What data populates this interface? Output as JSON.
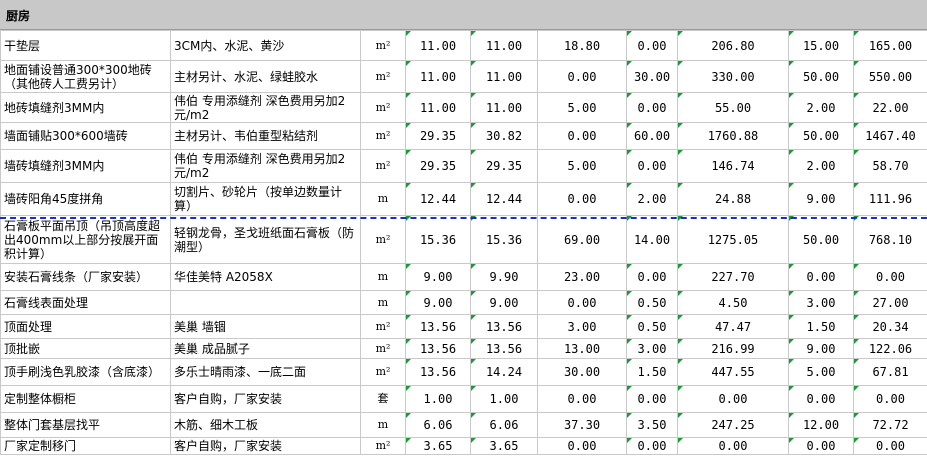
{
  "section": {
    "title": "厨房"
  },
  "rows": [
    {
      "name": "干垫层",
      "material": "3CM内、水泥、黄沙",
      "unit": "m²",
      "v1": "11.00",
      "v2": "11.00",
      "v3": "18.80",
      "v4": "0.00",
      "v5": "206.80",
      "v6": "15.00",
      "v7": "165.00"
    },
    {
      "name": "地面铺设普通300*300地砖（其他砖人工费另计）",
      "material": "主材另计、水泥、绿蛙胶水",
      "unit": "m²",
      "v1": "11.00",
      "v2": "11.00",
      "v3": "0.00",
      "v4": "30.00",
      "v5": "330.00",
      "v6": "50.00",
      "v7": "550.00"
    },
    {
      "name": "地砖填缝剂3MM内",
      "material": "伟伯 专用添缝剂  深色费用另加2元/m2",
      "unit": "m²",
      "v1": "11.00",
      "v2": "11.00",
      "v3": "5.00",
      "v4": "0.00",
      "v5": "55.00",
      "v6": "2.00",
      "v7": "22.00"
    },
    {
      "name": "墙面铺贴300*600墙砖",
      "material": "主材另计、韦伯重型粘结剂",
      "unit": "m²",
      "v1": "29.35",
      "v2": "30.82",
      "v3": "0.00",
      "v4": "60.00",
      "v5": "1760.88",
      "v6": "50.00",
      "v7": "1467.40"
    },
    {
      "name": "墙砖填缝剂3MM内",
      "material": "伟伯 专用添缝剂  深色费用另加2元/m2",
      "unit": "m²",
      "v1": "29.35",
      "v2": "29.35",
      "v3": "5.00",
      "v4": "0.00",
      "v5": "146.74",
      "v6": "2.00",
      "v7": "58.70"
    },
    {
      "name": "墙砖阳角45度拼角",
      "material": "切割片、砂轮片（按单边数量计算）",
      "unit": "m",
      "v1": "12.44",
      "v2": "12.44",
      "v3": "0.00",
      "v4": "2.00",
      "v5": "24.88",
      "v6": "9.00",
      "v7": "111.96"
    },
    {
      "name": "石膏板平面吊顶（吊顶高度超出400mm以上部分按展开面积计算）",
      "material": "轻钢龙骨，圣戈班纸面石膏板（防潮型）",
      "unit": "m²",
      "v1": "15.36",
      "v2": "15.36",
      "v3": "69.00",
      "v4": "14.00",
      "v5": "1275.05",
      "v6": "50.00",
      "v7": "768.10"
    },
    {
      "name": "安装石膏线条（厂家安装）",
      "material": "华佳美特  A2058X",
      "unit": "m",
      "v1": "9.00",
      "v2": "9.90",
      "v3": "23.00",
      "v4": "0.00",
      "v5": "227.70",
      "v6": "0.00",
      "v7": "0.00"
    },
    {
      "name": "石膏线表面处理",
      "material": "",
      "unit": "m",
      "v1": "9.00",
      "v2": "9.00",
      "v3": "0.00",
      "v4": "0.50",
      "v5": "4.50",
      "v6": "3.00",
      "v7": "27.00"
    },
    {
      "name": "顶面处理",
      "material": "美巢  墙锢",
      "unit": "m²",
      "v1": "13.56",
      "v2": "13.56",
      "v3": "3.00",
      "v4": "0.50",
      "v5": "47.47",
      "v6": "1.50",
      "v7": "20.34"
    },
    {
      "name": "顶批嵌",
      "material": "美巢  成品腻子",
      "unit": "m²",
      "v1": "13.56",
      "v2": "13.56",
      "v3": "13.00",
      "v4": "3.00",
      "v5": "216.99",
      "v6": "9.00",
      "v7": "122.06"
    },
    {
      "name": "顶手刷浅色乳胶漆（含底漆）",
      "material": "多乐士晴雨漆、一底二面",
      "unit": "m²",
      "v1": "13.56",
      "v2": "14.24",
      "v3": "30.00",
      "v4": "1.50",
      "v5": "447.55",
      "v6": "5.00",
      "v7": "67.81"
    },
    {
      "name": "定制整体橱柜",
      "material": "客户自购，厂家安装",
      "unit": "套",
      "v1": "1.00",
      "v2": "1.00",
      "v3": "0.00",
      "v4": "0.00",
      "v5": "0.00",
      "v6": "0.00",
      "v7": "0.00"
    },
    {
      "name": "整体门套基层找平",
      "material": "木筋、细木工板",
      "unit": "m",
      "v1": "6.06",
      "v2": "6.06",
      "v3": "37.30",
      "v4": "3.50",
      "v5": "247.25",
      "v6": "12.00",
      "v7": "72.72"
    },
    {
      "name": "厂家定制移门",
      "material": "客户自购，厂家安装",
      "unit": "m²",
      "v1": "3.65",
      "v2": "3.65",
      "v3": "0.00",
      "v4": "0.00",
      "v5": "0.00",
      "v6": "0.00",
      "v7": "0.00"
    }
  ]
}
